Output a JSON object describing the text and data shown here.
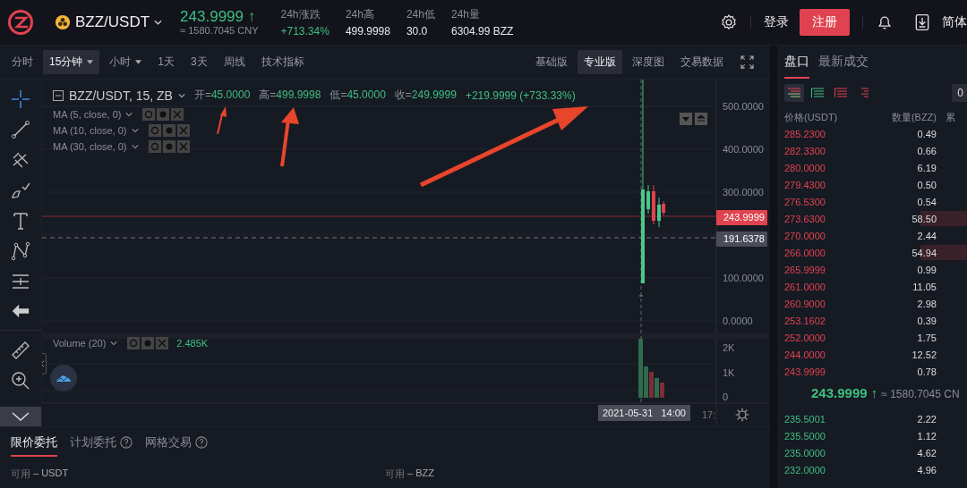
{
  "header": {
    "pair": "BZZ/USDT",
    "price": "243.9999",
    "price_arrow": "↑",
    "price_cny": "≈ 1580.7045 CNY",
    "stats": [
      {
        "label": "24h涨跌",
        "value": "+713.34%",
        "kind": "up"
      },
      {
        "label": "24h高",
        "value": "499.9998",
        "kind": "plain"
      },
      {
        "label": "24h低",
        "value": "30.0",
        "kind": "plain"
      },
      {
        "label": "24h量",
        "value": "6304.99 BZZ",
        "kind": "plain"
      }
    ],
    "login": "登录",
    "register": "注册",
    "language": "简体"
  },
  "toolbar": {
    "intervals": [
      {
        "label": "分时",
        "selected": false,
        "dropdown": false
      },
      {
        "label": "15分钟",
        "selected": true,
        "dropdown": true
      },
      {
        "label": "小时",
        "selected": false,
        "dropdown": true
      },
      {
        "label": "1天",
        "selected": false,
        "dropdown": false
      },
      {
        "label": "3天",
        "selected": false,
        "dropdown": false
      },
      {
        "label": "周线",
        "selected": false,
        "dropdown": false
      },
      {
        "label": "技术指标",
        "selected": false,
        "dropdown": false
      }
    ],
    "views": [
      {
        "label": "基础版",
        "selected": false
      },
      {
        "label": "专业版",
        "selected": true
      },
      {
        "label": "深度图",
        "selected": false
      },
      {
        "label": "交易数据",
        "selected": false
      }
    ]
  },
  "chart": {
    "title": "BZZ/USDT, 15, ZB",
    "ohlc": [
      {
        "label": "开=",
        "value": "45.0000"
      },
      {
        "label": "高=",
        "value": "499.9998"
      },
      {
        "label": "低=",
        "value": "45.0000"
      },
      {
        "label": "收=",
        "value": "249.9999"
      }
    ],
    "change": "+219.9999 (+733.33%)",
    "indicators": [
      "MA (5, close, 0)",
      "MA (10, close, 0)",
      "MA (30, close, 0)"
    ],
    "price_ticks": [
      "500.0000",
      "400.0000",
      "300.0000",
      "100.0000",
      "0.0000"
    ],
    "last_price": "243.9999",
    "crosshair_price": "191.6378",
    "volume_title": "Volume (20)",
    "volume_value": "2.485K",
    "volume_ticks": [
      "2K",
      "1K",
      "0"
    ],
    "crosshair_time": "2021-05-31   14:00",
    "time_tick": "17:"
  },
  "orderbook": {
    "tabs": [
      {
        "label": "盘口",
        "selected": true
      },
      {
        "label": "最新成交",
        "selected": false
      }
    ],
    "modes": [
      {
        "kind": "both",
        "selected": true
      },
      {
        "kind": "bids",
        "selected": false
      },
      {
        "kind": "asks",
        "selected": false
      },
      {
        "kind": "compact",
        "selected": false
      }
    ],
    "precision": "0",
    "columns": [
      "价格(USDT)",
      "数量(BZZ)",
      "累"
    ],
    "asks": [
      {
        "price": "285.2300",
        "amount": "0.49",
        "kind": "plain"
      },
      {
        "price": "282.3300",
        "amount": "0.66",
        "kind": "plain"
      },
      {
        "price": "280.0000",
        "amount": "6.19",
        "kind": "plain"
      },
      {
        "price": "279.4300",
        "amount": "0.50",
        "kind": "plain"
      },
      {
        "price": "276.5300",
        "amount": "0.54",
        "kind": "plain"
      },
      {
        "price": "273.6300",
        "amount": "58.50",
        "kind": "deep"
      },
      {
        "price": "270.0000",
        "amount": "2.44",
        "kind": "plain"
      },
      {
        "price": "266.0000",
        "amount": "54.94",
        "kind": "deep"
      },
      {
        "price": "265.9999",
        "amount": "0.99",
        "kind": "plain"
      },
      {
        "price": "261.0000",
        "amount": "11.05",
        "kind": "plain"
      },
      {
        "price": "260.9000",
        "amount": "2.98",
        "kind": "plain"
      },
      {
        "price": "253.1602",
        "amount": "0.39",
        "kind": "plain"
      },
      {
        "price": "252.0000",
        "amount": "1.75",
        "kind": "plain"
      },
      {
        "price": "244.0000",
        "amount": "12.52",
        "kind": "plain"
      },
      {
        "price": "243.9999",
        "amount": "0.78",
        "kind": "plain"
      }
    ],
    "last_price": "243.9999",
    "last_arrow": "↑",
    "last_cny": "≈ 1580.7045 CN",
    "bids": [
      {
        "price": "235.5001",
        "amount": "2.22"
      },
      {
        "price": "235.5000",
        "amount": "1.12"
      },
      {
        "price": "235.0000",
        "amount": "4.62"
      },
      {
        "price": "232.0000",
        "amount": "4.96"
      }
    ]
  },
  "orders": {
    "tabs": [
      {
        "label": "限价委托",
        "selected": true,
        "help": false
      },
      {
        "label": "计划委托",
        "selected": false,
        "help": true
      },
      {
        "label": "网格交易",
        "selected": false,
        "help": true
      }
    ],
    "balances": [
      {
        "label": "可用",
        "value": "– USDT"
      },
      {
        "label": "可用",
        "value": "– BZZ"
      }
    ]
  }
}
